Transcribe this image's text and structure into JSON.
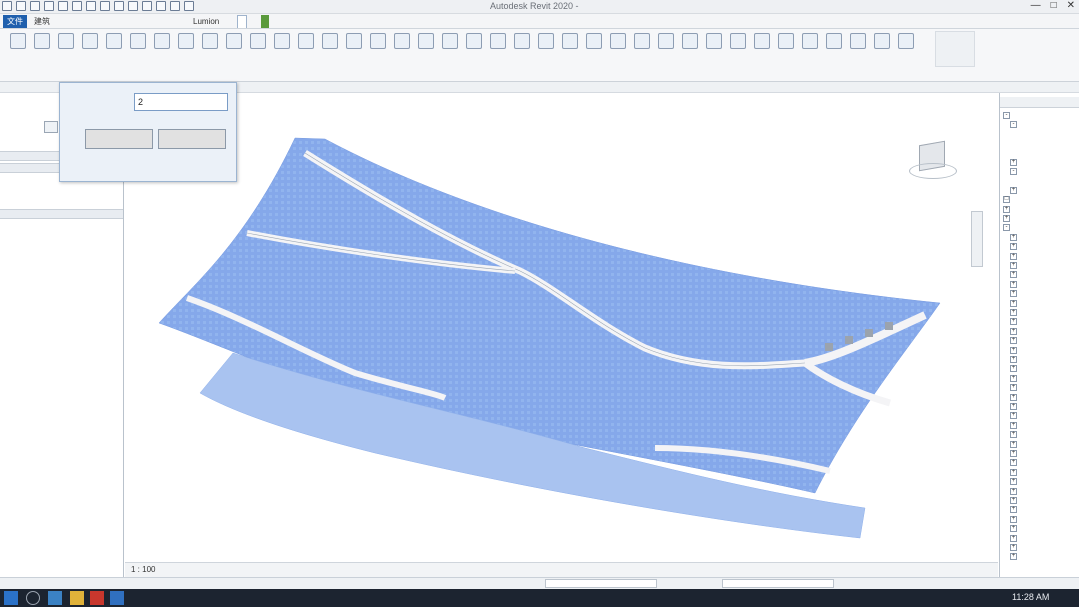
{
  "titlebar": {
    "title": "Autodesk Revit 2020 -",
    "user": "",
    "window_controls": [
      "—",
      "□",
      "✕"
    ]
  },
  "tabs": [
    {
      "label": "文件",
      "kind": "file"
    },
    {
      "label": "建筑",
      "kind": "normal"
    },
    {
      "label": "",
      "kind": "normal"
    },
    {
      "label": "",
      "kind": "normal"
    },
    {
      "label": "",
      "kind": "normal"
    },
    {
      "label": "",
      "kind": "normal"
    },
    {
      "label": "",
      "kind": "normal"
    },
    {
      "label": "",
      "kind": "normal"
    },
    {
      "label": "",
      "kind": "normal"
    },
    {
      "label": "",
      "kind": "normal"
    },
    {
      "label": "",
      "kind": "normal"
    },
    {
      "label": "",
      "kind": "normal"
    },
    {
      "label": "",
      "kind": "normal"
    },
    {
      "label": "",
      "kind": "normal"
    },
    {
      "label": "Lumion",
      "kind": "normal"
    },
    {
      "label": "",
      "kind": "normal"
    },
    {
      "label": "",
      "kind": "active"
    },
    {
      "label": "",
      "kind": "normal"
    },
    {
      "label": "",
      "kind": "ctx"
    }
  ],
  "ribbon_groups": [
    "",
    "",
    "",
    "",
    "",
    "",
    "",
    ""
  ],
  "options_bar": {
    "label": ""
  },
  "left_panel": {
    "type_label": "",
    "sections": [
      {
        "header": "",
        "rows": []
      },
      {
        "header": "",
        "rows": [
          "",
          "",
          ""
        ]
      },
      {
        "header": "",
        "rows": [
          {
            "name": "",
            "value": ""
          },
          {
            "name": "",
            "value": ""
          }
        ]
      }
    ],
    "apply_link": ""
  },
  "dialog": {
    "label": "",
    "value": "2",
    "ok": "",
    "cancel": ""
  },
  "browser": {
    "header": "",
    "items": [
      {
        "text": "",
        "indent": 0,
        "expander": "-"
      },
      {
        "text": "",
        "indent": 1,
        "expander": "-"
      },
      {
        "text": "",
        "indent": 2,
        "expander": ""
      },
      {
        "text": "",
        "indent": 2,
        "expander": ""
      },
      {
        "text": "",
        "indent": 2,
        "expander": ""
      },
      {
        "text": "",
        "indent": 1,
        "expander": "+"
      },
      {
        "text": "",
        "indent": 1,
        "expander": "-"
      },
      {
        "text": "",
        "indent": 2,
        "expander": ""
      },
      {
        "text": "",
        "indent": 1,
        "expander": "+"
      },
      {
        "text": "",
        "indent": 0,
        "expander": "□"
      },
      {
        "text": "",
        "indent": 0,
        "expander": "+"
      },
      {
        "text": "",
        "indent": 0,
        "expander": "+"
      },
      {
        "text": "",
        "indent": 0,
        "expander": "-"
      },
      {
        "text": "",
        "indent": 1,
        "expander": "+"
      },
      {
        "text": "",
        "indent": 1,
        "expander": "+"
      },
      {
        "text": "",
        "indent": 1,
        "expander": "+"
      },
      {
        "text": "",
        "indent": 1,
        "expander": "+"
      },
      {
        "text": "",
        "indent": 1,
        "expander": "+"
      },
      {
        "text": "",
        "indent": 1,
        "expander": "+"
      },
      {
        "text": "",
        "indent": 1,
        "expander": "+"
      },
      {
        "text": "",
        "indent": 1,
        "expander": "+"
      },
      {
        "text": "",
        "indent": 1,
        "expander": "+"
      },
      {
        "text": "",
        "indent": 1,
        "expander": "+"
      },
      {
        "text": "",
        "indent": 1,
        "expander": "+"
      },
      {
        "text": "",
        "indent": 1,
        "expander": "+"
      },
      {
        "text": "",
        "indent": 1,
        "expander": "+"
      },
      {
        "text": "",
        "indent": 1,
        "expander": "+"
      },
      {
        "text": "",
        "indent": 1,
        "expander": "+"
      },
      {
        "text": "",
        "indent": 1,
        "expander": "+"
      },
      {
        "text": "",
        "indent": 1,
        "expander": "+"
      },
      {
        "text": "",
        "indent": 1,
        "expander": "+"
      },
      {
        "text": "",
        "indent": 1,
        "expander": "+"
      },
      {
        "text": "",
        "indent": 1,
        "expander": "+"
      },
      {
        "text": "",
        "indent": 1,
        "expander": "+"
      },
      {
        "text": "",
        "indent": 1,
        "expander": "+"
      },
      {
        "text": "",
        "indent": 1,
        "expander": "+"
      },
      {
        "text": "",
        "indent": 1,
        "expander": "+"
      },
      {
        "text": "",
        "indent": 1,
        "expander": "+"
      },
      {
        "text": "",
        "indent": 1,
        "expander": "+"
      },
      {
        "text": "",
        "indent": 1,
        "expander": "+"
      },
      {
        "text": "",
        "indent": 1,
        "expander": "+"
      },
      {
        "text": "",
        "indent": 1,
        "expander": "+"
      },
      {
        "text": "",
        "indent": 1,
        "expander": "+"
      },
      {
        "text": "",
        "indent": 1,
        "expander": "+"
      },
      {
        "text": "",
        "indent": 1,
        "expander": "+"
      },
      {
        "text": "",
        "indent": 1,
        "expander": "+"
      },
      {
        "text": "",
        "indent": 1,
        "expander": "+"
      },
      {
        "text": "",
        "indent": 1,
        "expander": "+"
      }
    ]
  },
  "viewbar": {
    "scale": "1 : 100"
  },
  "statusbar": {
    "message": "",
    "workset": ""
  },
  "taskbar": {
    "clock": "11:28 AM"
  },
  "colors": {
    "surface": "#7ea3e8",
    "surface_light": "#a9c3f0",
    "road": "#f4f4f6",
    "file_tab": "#1f5fad",
    "context_tab": "#5a9a3c"
  }
}
